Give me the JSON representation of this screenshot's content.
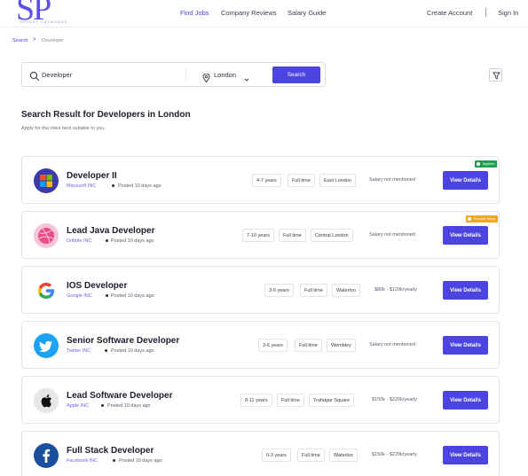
{
  "brand": {
    "logo_letters": "SP",
    "logo_tagline": "SPEEDY PAYWARDS"
  },
  "nav": {
    "find_jobs": "Find Jobs",
    "company_reviews": "Company Reviews",
    "salary_guide": "Salary Guide",
    "create_account": "Create Account",
    "sign_in": "Sign In"
  },
  "breadcrumb": {
    "root": "Search",
    "separator": ">",
    "current": "Developer"
  },
  "search": {
    "query": "Developer",
    "location": "London",
    "button": "Search"
  },
  "results": {
    "title": "Search Result for Developers in London",
    "subtitle": "Apply for the roles best suitable to you"
  },
  "colors": {
    "accent": "#4b44e0",
    "applied": "#1f9d50",
    "expiring": "#f3a81b"
  },
  "jobs": [
    {
      "title": "Developer II",
      "company": "Microsoft INC",
      "posted": "Posted 10 days ago",
      "experience": "4-7 years",
      "type": "Full time",
      "location": "East London",
      "salary": "Salary not mentioned",
      "button": "View Details",
      "badge": "Applied",
      "logo_icon": "microsoft-icon"
    },
    {
      "title": "Lead Java Developer",
      "company": "Dribble INC",
      "posted": "Posted 10 days ago",
      "experience": "7-10 years",
      "type": "Full time",
      "location": "Central London",
      "salary": "Salary not mentioned",
      "button": "View Details",
      "badge": "Expires Soon",
      "logo_icon": "dribbble-icon"
    },
    {
      "title": "IOS Developer",
      "company": "Google INC",
      "posted": "Posted 10 days ago",
      "experience": "3-6 years",
      "type": "Full time",
      "location": "Waterloo",
      "salary": "$80k - $120k/yearly",
      "button": "View Details",
      "logo_icon": "google-icon"
    },
    {
      "title": "Senior Software Developer",
      "company": "Twitter INC",
      "posted": "Posted 10 days ago",
      "experience": "3-6 years",
      "type": "Full time",
      "location": "Wembley",
      "salary": "Salary not mentioned",
      "button": "View Details",
      "logo_icon": "twitter-icon"
    },
    {
      "title": "Lead Software Developer",
      "company": "Apple INC",
      "posted": "Posted 10 days ago",
      "experience": "8-11 years",
      "type": "Full time",
      "location": "Trafalgar Square",
      "salary": "$150k - $220k/yearly",
      "button": "View Details",
      "logo_icon": "apple-icon"
    },
    {
      "title": "Full Stack Developer",
      "company": "Facebook INC",
      "posted": "Posted 10 days ago",
      "experience": "0-3 years",
      "type": "Full time",
      "location": "Waterloo",
      "salary": "$150k - $220k/yearly",
      "button": "View Details",
      "logo_icon": "facebook-icon"
    }
  ]
}
